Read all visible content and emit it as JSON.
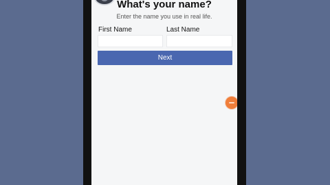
{
  "screen": {
    "title": "What's your name?",
    "subtitle": "Enter the name you use in real life.",
    "first_name": {
      "label": "First Name",
      "value": "",
      "placeholder": ""
    },
    "last_name": {
      "label": "Last Name",
      "value": "",
      "placeholder": ""
    },
    "next_label": "Next"
  },
  "colors": {
    "background": "#5b6b8f",
    "primary_button": "#4a67b0",
    "screen_bg": "#f5f6f7",
    "fab": "#f07e3a"
  },
  "icons": {
    "avatar": "profile-avatar-icon",
    "floating": "floating-bubble-icon"
  }
}
